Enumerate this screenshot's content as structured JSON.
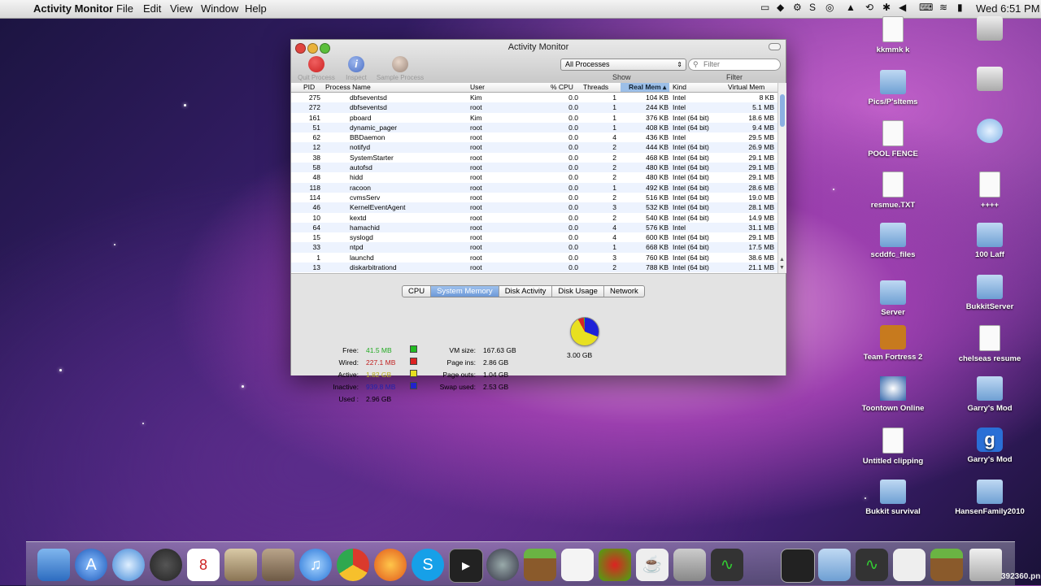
{
  "menubar": {
    "apple_icon": "apple-logo",
    "app_name": "Activity Monitor",
    "menus": [
      "File",
      "Edit",
      "View",
      "Window",
      "Help"
    ],
    "clock": "Wed 6:51 PM"
  },
  "window": {
    "title": "Activity Monitor",
    "toolbar": {
      "quit": "Quit Process",
      "inspect": "Inspect",
      "sample": "Sample Process"
    },
    "process_filter": {
      "selected": "All Processes",
      "label": "Show"
    },
    "search": {
      "placeholder": "Filter",
      "label": "Filter"
    },
    "columns": [
      "PID",
      "Process Name",
      "User",
      "% CPU",
      "Threads",
      "Real Mem",
      "Kind",
      "Virtual Mem"
    ],
    "sorted_column": "Real Mem",
    "rows": [
      [
        "275",
        "dbfseventsd",
        "Kim",
        "0.0",
        "1",
        "104 KB",
        "Intel",
        "8 KB"
      ],
      [
        "272",
        "dbfseventsd",
        "root",
        "0.0",
        "1",
        "244 KB",
        "Intel",
        "5.1 MB"
      ],
      [
        "161",
        "pboard",
        "Kim",
        "0.0",
        "1",
        "376 KB",
        "Intel (64 bit)",
        "18.6 MB"
      ],
      [
        "51",
        "dynamic_pager",
        "root",
        "0.0",
        "1",
        "408 KB",
        "Intel (64 bit)",
        "9.4 MB"
      ],
      [
        "62",
        "BBDaemon",
        "root",
        "0.0",
        "4",
        "436 KB",
        "Intel",
        "29.5 MB"
      ],
      [
        "12",
        "notifyd",
        "root",
        "0.0",
        "2",
        "444 KB",
        "Intel (64 bit)",
        "26.9 MB"
      ],
      [
        "38",
        "SystemStarter",
        "root",
        "0.0",
        "2",
        "468 KB",
        "Intel (64 bit)",
        "29.1 MB"
      ],
      [
        "58",
        "autofsd",
        "root",
        "0.0",
        "2",
        "480 KB",
        "Intel (64 bit)",
        "29.1 MB"
      ],
      [
        "48",
        "hidd",
        "root",
        "0.0",
        "2",
        "480 KB",
        "Intel (64 bit)",
        "29.1 MB"
      ],
      [
        "118",
        "racoon",
        "root",
        "0.0",
        "1",
        "492 KB",
        "Intel (64 bit)",
        "28.6 MB"
      ],
      [
        "114",
        "cvmsServ",
        "root",
        "0.0",
        "2",
        "516 KB",
        "Intel (64 bit)",
        "19.0 MB"
      ],
      [
        "46",
        "KernelEventAgent",
        "root",
        "0.0",
        "3",
        "532 KB",
        "Intel (64 bit)",
        "28.1 MB"
      ],
      [
        "10",
        "kextd",
        "root",
        "0.0",
        "2",
        "540 KB",
        "Intel (64 bit)",
        "14.9 MB"
      ],
      [
        "64",
        "hamachid",
        "root",
        "0.0",
        "4",
        "576 KB",
        "Intel",
        "31.1 MB"
      ],
      [
        "15",
        "syslogd",
        "root",
        "0.0",
        "4",
        "600 KB",
        "Intel (64 bit)",
        "29.1 MB"
      ],
      [
        "33",
        "ntpd",
        "root",
        "0.0",
        "1",
        "668 KB",
        "Intel (64 bit)",
        "17.5 MB"
      ],
      [
        "1",
        "launchd",
        "root",
        "0.0",
        "3",
        "760 KB",
        "Intel (64 bit)",
        "38.6 MB"
      ],
      [
        "13",
        "diskarbitrationd",
        "root",
        "0.0",
        "2",
        "788 KB",
        "Intel (64 bit)",
        "21.1 MB"
      ]
    ],
    "tabs": [
      "CPU",
      "System Memory",
      "Disk Activity",
      "Disk Usage",
      "Network"
    ],
    "selected_tab": "System Memory",
    "memory": {
      "free": {
        "label": "Free:",
        "value": "41.5 MB",
        "color": "#22bb22"
      },
      "wired": {
        "label": "Wired:",
        "value": "227.1 MB",
        "color": "#dd2222"
      },
      "active": {
        "label": "Active:",
        "value": "1.82 GB",
        "color": "#e6e020"
      },
      "inactive": {
        "label": "Inactive:",
        "value": "939.8 MB",
        "color": "#2222cc"
      },
      "used": {
        "label": "Used :",
        "value": "2.96 GB"
      },
      "vm_size": {
        "label": "VM size:",
        "value": "167.63 GB"
      },
      "page_ins": {
        "label": "Page ins:",
        "value": "2.86 GB"
      },
      "page_outs": {
        "label": "Page outs:",
        "value": "1.04 GB"
      },
      "swap_used": {
        "label": "Swap used:",
        "value": "2.53 GB"
      },
      "total": "3.00 GB"
    }
  },
  "desktop_icons": [
    {
      "label": "kkmmk k",
      "type": "doc"
    },
    {
      "label": "Pics/P'sItems",
      "type": "folder"
    },
    {
      "label": "POOL FENCE",
      "type": "doc"
    },
    {
      "label": "resmue.TXT",
      "type": "doc"
    },
    {
      "label": "scddfc_files",
      "type": "folder"
    },
    {
      "label": "Server",
      "type": "folder"
    },
    {
      "label": "Team Fortress 2",
      "type": "app"
    },
    {
      "label": "Toontown Online",
      "type": "app"
    },
    {
      "label": "Untitled clipping",
      "type": "doc"
    },
    {
      "label": "Bukkit survival",
      "type": "folder"
    },
    {
      "label": "++++",
      "type": "doc"
    },
    {
      "label": "100 Laff",
      "type": "folder"
    },
    {
      "label": "BukkitServer",
      "type": "folder"
    },
    {
      "label": "chelseas resume",
      "type": "doc"
    },
    {
      "label": "Garry's Mod",
      "type": "folder"
    },
    {
      "label": "Garry's Mod",
      "type": "app"
    },
    {
      "label": "HansenFamily2010",
      "type": "folder"
    }
  ],
  "watermark": "392360.pn"
}
